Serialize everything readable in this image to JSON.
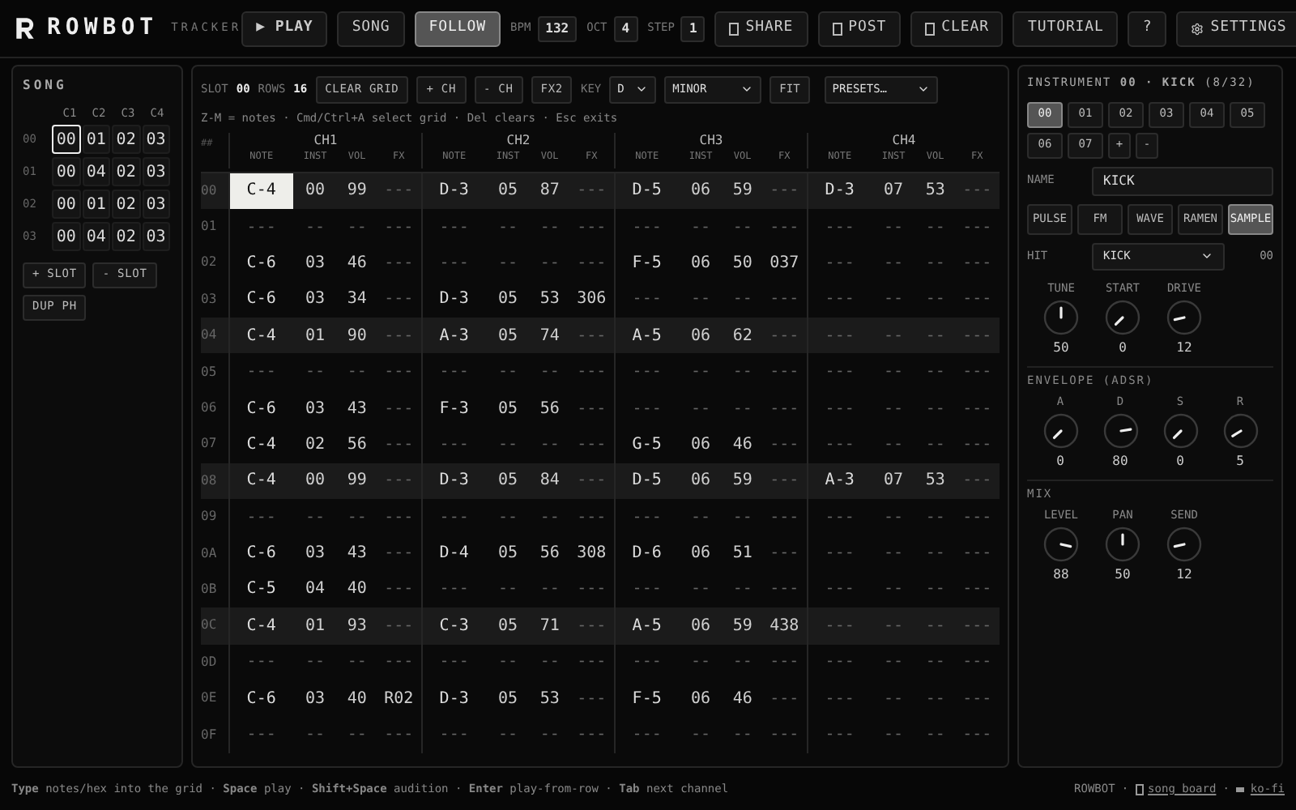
{
  "header": {
    "brand": "ROWBOT",
    "subtitle": "TRACKER",
    "buttons": [
      {
        "kind": "play",
        "label": "▶ PLAY",
        "selected": false
      },
      {
        "kind": "text",
        "label": "SONG",
        "selected": false
      },
      {
        "kind": "text",
        "label": "FOLLOW",
        "selected": true
      }
    ],
    "fields": [
      {
        "label": "BPM",
        "value": "132"
      },
      {
        "label": "OCT",
        "value": "4"
      },
      {
        "label": "STEP",
        "value": "1"
      }
    ],
    "actions": [
      {
        "kind": "boxed",
        "label": "SHARE"
      },
      {
        "kind": "boxed",
        "label": "POST"
      },
      {
        "kind": "boxed",
        "label": "CLEAR"
      },
      {
        "kind": "text",
        "label": "TUTORIAL"
      },
      {
        "kind": "text",
        "label": "?"
      },
      {
        "kind": "gear",
        "label": "SETTINGS"
      }
    ]
  },
  "song": {
    "title": "SONG",
    "columns": [
      "C1",
      "C2",
      "C3",
      "C4"
    ],
    "rows": [
      {
        "label": "00",
        "cells": [
          {
            "value": "00",
            "selected": true
          },
          {
            "value": "01",
            "selected": false
          },
          {
            "value": "02",
            "selected": false
          },
          {
            "value": "03",
            "selected": false
          }
        ]
      },
      {
        "label": "01",
        "cells": [
          {
            "value": "00",
            "selected": false
          },
          {
            "value": "04",
            "selected": false
          },
          {
            "value": "02",
            "selected": false
          },
          {
            "value": "03",
            "selected": false
          }
        ]
      },
      {
        "label": "02",
        "cells": [
          {
            "value": "00",
            "selected": false
          },
          {
            "value": "01",
            "selected": false
          },
          {
            "value": "02",
            "selected": false
          },
          {
            "value": "03",
            "selected": false
          }
        ]
      },
      {
        "label": "03",
        "cells": [
          {
            "value": "00",
            "selected": false
          },
          {
            "value": "04",
            "selected": false
          },
          {
            "value": "02",
            "selected": false
          },
          {
            "value": "03",
            "selected": false
          }
        ]
      }
    ],
    "buttons": [
      "+ SLOT",
      "- SLOT",
      "DUP PH"
    ]
  },
  "pattern": {
    "slot_label": "SLOT",
    "slot": "00",
    "rows_label": "ROWS",
    "rows_count": "16",
    "tools": [
      "CLEAR GRID",
      "+ CH",
      "- CH",
      "FX2"
    ],
    "key_label": "KEY",
    "key": "D",
    "scale": "MINOR",
    "fit": "FIT",
    "presets": "PRESETS…",
    "hint": "Z-M = notes · Cmd/Ctrl+A select grid · Del clears · Esc exits",
    "index_header": "##",
    "channels": [
      {
        "label": "CH1",
        "columns": [
          "NOTE",
          "INST",
          "VOL",
          "FX"
        ]
      },
      {
        "label": "CH2",
        "columns": [
          "NOTE",
          "INST",
          "VOL",
          "FX"
        ]
      },
      {
        "label": "CH3",
        "columns": [
          "NOTE",
          "INST",
          "VOL",
          "FX"
        ]
      },
      {
        "label": "CH4",
        "columns": [
          "NOTE",
          "INST",
          "VOL",
          "FX"
        ]
      }
    ],
    "rows": [
      {
        "label": "00",
        "highlight": true,
        "cells": [
          {
            "note": "C-4",
            "inst": "00",
            "vol": "99",
            "fx": "---",
            "selected": true
          },
          {
            "note": "D-3",
            "inst": "05",
            "vol": "87",
            "fx": "---",
            "selected": false
          },
          {
            "note": "D-5",
            "inst": "06",
            "vol": "59",
            "fx": "---",
            "selected": false
          },
          {
            "note": "D-3",
            "inst": "07",
            "vol": "53",
            "fx": "---",
            "selected": false
          }
        ]
      },
      {
        "label": "01",
        "highlight": false,
        "cells": [
          {
            "note": "---",
            "inst": "--",
            "vol": "--",
            "fx": "---",
            "selected": false
          },
          {
            "note": "---",
            "inst": "--",
            "vol": "--",
            "fx": "---",
            "selected": false
          },
          {
            "note": "---",
            "inst": "--",
            "vol": "--",
            "fx": "---",
            "selected": false
          },
          {
            "note": "---",
            "inst": "--",
            "vol": "--",
            "fx": "---",
            "selected": false
          }
        ]
      },
      {
        "label": "02",
        "highlight": false,
        "cells": [
          {
            "note": "C-6",
            "inst": "03",
            "vol": "46",
            "fx": "---",
            "selected": false
          },
          {
            "note": "---",
            "inst": "--",
            "vol": "--",
            "fx": "---",
            "selected": false
          },
          {
            "note": "F-5",
            "inst": "06",
            "vol": "50",
            "fx": "037",
            "selected": false
          },
          {
            "note": "---",
            "inst": "--",
            "vol": "--",
            "fx": "---",
            "selected": false
          }
        ]
      },
      {
        "label": "03",
        "highlight": false,
        "cells": [
          {
            "note": "C-6",
            "inst": "03",
            "vol": "34",
            "fx": "---",
            "selected": false
          },
          {
            "note": "D-3",
            "inst": "05",
            "vol": "53",
            "fx": "306",
            "selected": false
          },
          {
            "note": "---",
            "inst": "--",
            "vol": "--",
            "fx": "---",
            "selected": false
          },
          {
            "note": "---",
            "inst": "--",
            "vol": "--",
            "fx": "---",
            "selected": false
          }
        ]
      },
      {
        "label": "04",
        "highlight": true,
        "cells": [
          {
            "note": "C-4",
            "inst": "01",
            "vol": "90",
            "fx": "---",
            "selected": false
          },
          {
            "note": "A-3",
            "inst": "05",
            "vol": "74",
            "fx": "---",
            "selected": false
          },
          {
            "note": "A-5",
            "inst": "06",
            "vol": "62",
            "fx": "---",
            "selected": false
          },
          {
            "note": "---",
            "inst": "--",
            "vol": "--",
            "fx": "---",
            "selected": false
          }
        ]
      },
      {
        "label": "05",
        "highlight": false,
        "cells": [
          {
            "note": "---",
            "inst": "--",
            "vol": "--",
            "fx": "---",
            "selected": false
          },
          {
            "note": "---",
            "inst": "--",
            "vol": "--",
            "fx": "---",
            "selected": false
          },
          {
            "note": "---",
            "inst": "--",
            "vol": "--",
            "fx": "---",
            "selected": false
          },
          {
            "note": "---",
            "inst": "--",
            "vol": "--",
            "fx": "---",
            "selected": false
          }
        ]
      },
      {
        "label": "06",
        "highlight": false,
        "cells": [
          {
            "note": "C-6",
            "inst": "03",
            "vol": "43",
            "fx": "---",
            "selected": false
          },
          {
            "note": "F-3",
            "inst": "05",
            "vol": "56",
            "fx": "---",
            "selected": false
          },
          {
            "note": "---",
            "inst": "--",
            "vol": "--",
            "fx": "---",
            "selected": false
          },
          {
            "note": "---",
            "inst": "--",
            "vol": "--",
            "fx": "---",
            "selected": false
          }
        ]
      },
      {
        "label": "07",
        "highlight": false,
        "cells": [
          {
            "note": "C-4",
            "inst": "02",
            "vol": "56",
            "fx": "---",
            "selected": false
          },
          {
            "note": "---",
            "inst": "--",
            "vol": "--",
            "fx": "---",
            "selected": false
          },
          {
            "note": "G-5",
            "inst": "06",
            "vol": "46",
            "fx": "---",
            "selected": false
          },
          {
            "note": "---",
            "inst": "--",
            "vol": "--",
            "fx": "---",
            "selected": false
          }
        ]
      },
      {
        "label": "08",
        "highlight": true,
        "cells": [
          {
            "note": "C-4",
            "inst": "00",
            "vol": "99",
            "fx": "---",
            "selected": false
          },
          {
            "note": "D-3",
            "inst": "05",
            "vol": "84",
            "fx": "---",
            "selected": false
          },
          {
            "note": "D-5",
            "inst": "06",
            "vol": "59",
            "fx": "---",
            "selected": false
          },
          {
            "note": "A-3",
            "inst": "07",
            "vol": "53",
            "fx": "---",
            "selected": false
          }
        ]
      },
      {
        "label": "09",
        "highlight": false,
        "cells": [
          {
            "note": "---",
            "inst": "--",
            "vol": "--",
            "fx": "---",
            "selected": false
          },
          {
            "note": "---",
            "inst": "--",
            "vol": "--",
            "fx": "---",
            "selected": false
          },
          {
            "note": "---",
            "inst": "--",
            "vol": "--",
            "fx": "---",
            "selected": false
          },
          {
            "note": "---",
            "inst": "--",
            "vol": "--",
            "fx": "---",
            "selected": false
          }
        ]
      },
      {
        "label": "0A",
        "highlight": false,
        "cells": [
          {
            "note": "C-6",
            "inst": "03",
            "vol": "43",
            "fx": "---",
            "selected": false
          },
          {
            "note": "D-4",
            "inst": "05",
            "vol": "56",
            "fx": "308",
            "selected": false
          },
          {
            "note": "D-6",
            "inst": "06",
            "vol": "51",
            "fx": "---",
            "selected": false
          },
          {
            "note": "---",
            "inst": "--",
            "vol": "--",
            "fx": "---",
            "selected": false
          }
        ]
      },
      {
        "label": "0B",
        "highlight": false,
        "cells": [
          {
            "note": "C-5",
            "inst": "04",
            "vol": "40",
            "fx": "---",
            "selected": false
          },
          {
            "note": "---",
            "inst": "--",
            "vol": "--",
            "fx": "---",
            "selected": false
          },
          {
            "note": "---",
            "inst": "--",
            "vol": "--",
            "fx": "---",
            "selected": false
          },
          {
            "note": "---",
            "inst": "--",
            "vol": "--",
            "fx": "---",
            "selected": false
          }
        ]
      },
      {
        "label": "0C",
        "highlight": true,
        "cells": [
          {
            "note": "C-4",
            "inst": "01",
            "vol": "93",
            "fx": "---",
            "selected": false
          },
          {
            "note": "C-3",
            "inst": "05",
            "vol": "71",
            "fx": "---",
            "selected": false
          },
          {
            "note": "A-5",
            "inst": "06",
            "vol": "59",
            "fx": "438",
            "selected": false
          },
          {
            "note": "---",
            "inst": "--",
            "vol": "--",
            "fx": "---",
            "selected": false
          }
        ]
      },
      {
        "label": "0D",
        "highlight": false,
        "cells": [
          {
            "note": "---",
            "inst": "--",
            "vol": "--",
            "fx": "---",
            "selected": false
          },
          {
            "note": "---",
            "inst": "--",
            "vol": "--",
            "fx": "---",
            "selected": false
          },
          {
            "note": "---",
            "inst": "--",
            "vol": "--",
            "fx": "---",
            "selected": false
          },
          {
            "note": "---",
            "inst": "--",
            "vol": "--",
            "fx": "---",
            "selected": false
          }
        ]
      },
      {
        "label": "0E",
        "highlight": false,
        "cells": [
          {
            "note": "C-6",
            "inst": "03",
            "vol": "40",
            "fx": "R02",
            "selected": false
          },
          {
            "note": "D-3",
            "inst": "05",
            "vol": "53",
            "fx": "---",
            "selected": false
          },
          {
            "note": "F-5",
            "inst": "06",
            "vol": "46",
            "fx": "---",
            "selected": false
          },
          {
            "note": "---",
            "inst": "--",
            "vol": "--",
            "fx": "---",
            "selected": false
          }
        ]
      },
      {
        "label": "0F",
        "highlight": false,
        "cells": [
          {
            "note": "---",
            "inst": "--",
            "vol": "--",
            "fx": "---",
            "selected": false
          },
          {
            "note": "---",
            "inst": "--",
            "vol": "--",
            "fx": "---",
            "selected": false
          },
          {
            "note": "---",
            "inst": "--",
            "vol": "--",
            "fx": "---",
            "selected": false
          },
          {
            "note": "---",
            "inst": "--",
            "vol": "--",
            "fx": "---",
            "selected": false
          }
        ]
      }
    ]
  },
  "instrument": {
    "title": "INSTRUMENT **00 · KICK** (8/32)",
    "slots": [
      {
        "label": "00",
        "selected": true
      },
      {
        "label": "01",
        "selected": false
      },
      {
        "label": "02",
        "selected": false
      },
      {
        "label": "03",
        "selected": false
      },
      {
        "label": "04",
        "selected": false
      },
      {
        "label": "05",
        "selected": false
      },
      {
        "label": "06",
        "selected": false
      },
      {
        "label": "07",
        "selected": false
      }
    ],
    "slot_buttons": [
      "+",
      "-"
    ],
    "name_label": "NAME",
    "name": "KICK",
    "types": [
      {
        "label": "PULSE",
        "selected": false
      },
      {
        "label": "FM",
        "selected": false
      },
      {
        "label": "WAVE",
        "selected": false
      },
      {
        "label": "RAMEN",
        "selected": false
      },
      {
        "label": "SAMPLE",
        "selected": true
      }
    ],
    "hit_label": "HIT",
    "hit": "KICK",
    "hit_value": "00",
    "sections": [
      {
        "knobs": [
          {
            "label": "TUNE",
            "value": "50"
          },
          {
            "label": "START",
            "value": "0"
          },
          {
            "label": "DRIVE",
            "value": "12"
          }
        ]
      },
      {
        "title": "ENVELOPE (ADSR)",
        "knobs": [
          {
            "label": "A",
            "value": "0"
          },
          {
            "label": "D",
            "value": "80"
          },
          {
            "label": "S",
            "value": "0"
          },
          {
            "label": "R",
            "value": "5"
          }
        ]
      },
      {
        "title": "MIX",
        "knobs": [
          {
            "label": "LEVEL",
            "value": "88"
          },
          {
            "label": "PAN",
            "value": "50"
          },
          {
            "label": "SEND",
            "value": "12"
          }
        ]
      }
    ]
  },
  "footer": {
    "help": "**Type** notes/hex into the grid · **Space** play · **Shift+Space** audition · **Enter** play-from-row · **Tab** next channel",
    "brand": "ROWBOT",
    "separator": "·",
    "links": [
      {
        "kind": "board",
        "label": "song board"
      },
      {
        "kind": "cup",
        "label": "ko-fi"
      }
    ]
  }
}
